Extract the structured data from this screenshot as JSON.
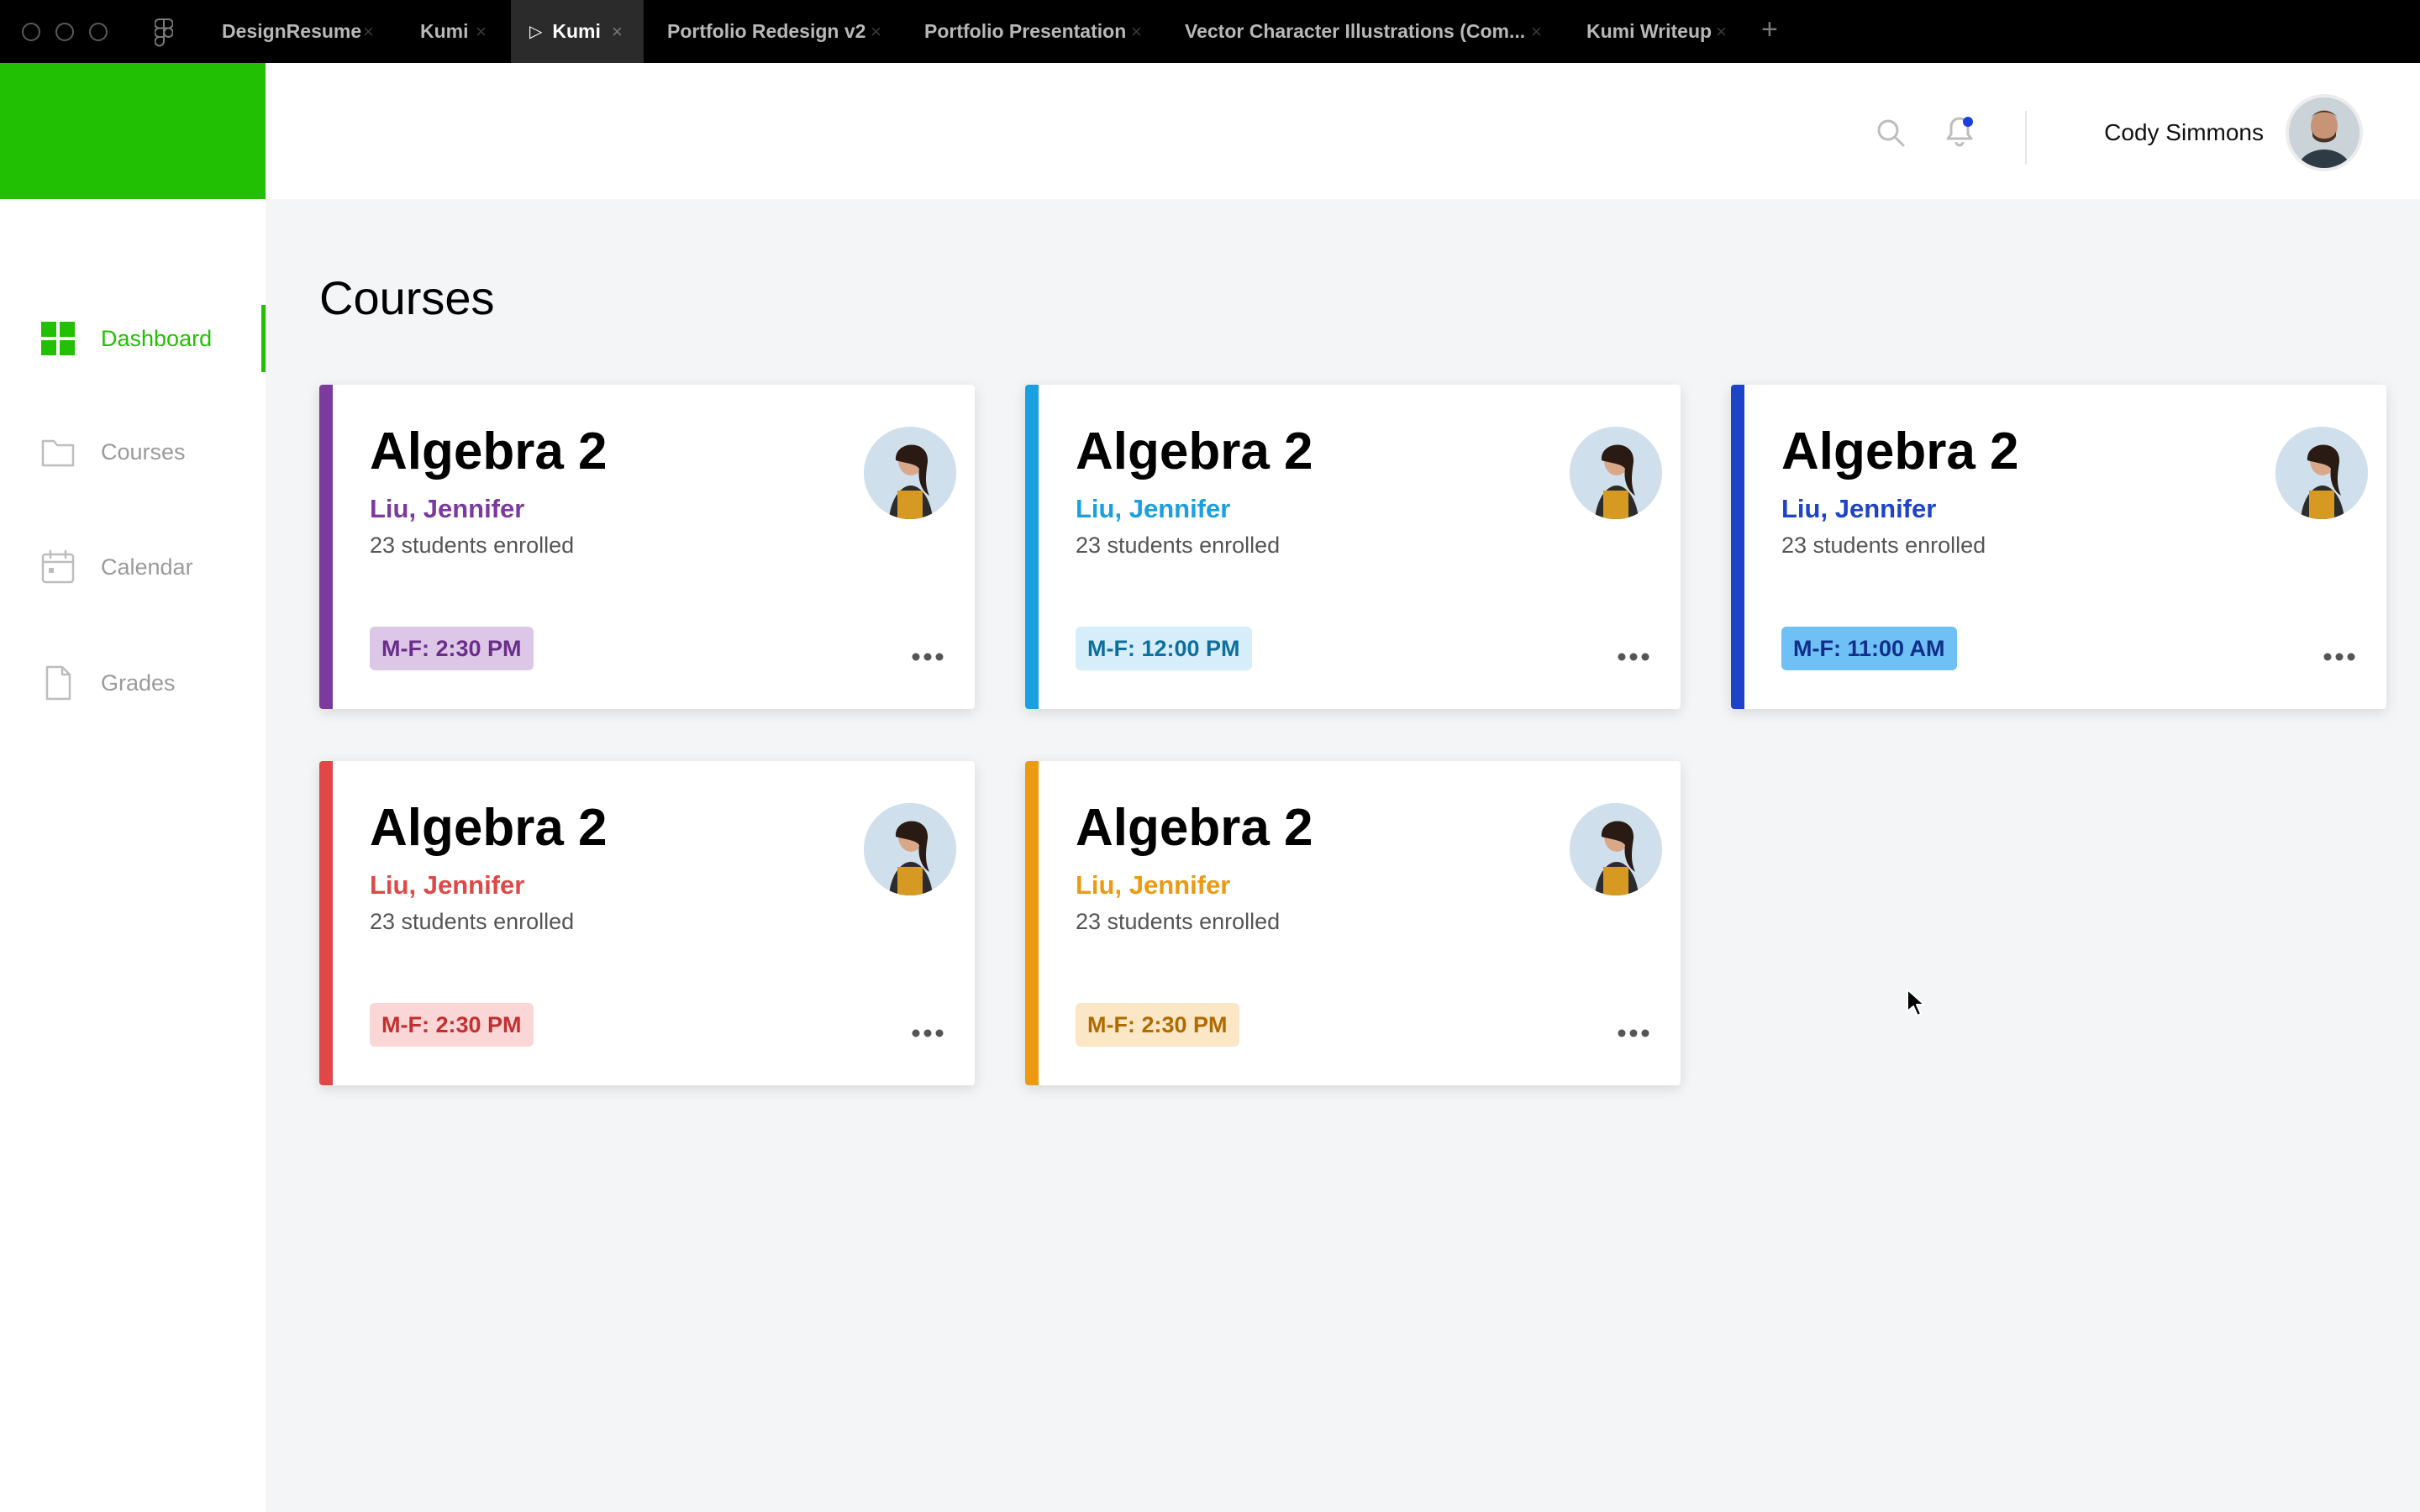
{
  "titlebar": {
    "tabs": [
      {
        "label": "DesignResume",
        "active": false
      },
      {
        "label": "Kumi",
        "active": false
      },
      {
        "label": "Kumi",
        "active": true
      },
      {
        "label": "Portfolio Redesign v2",
        "active": false
      },
      {
        "label": "Portfolio Presentation",
        "active": false
      },
      {
        "label": "Vector Character Illustrations (Com...",
        "active": false
      },
      {
        "label": "Kumi Writeup",
        "active": false
      }
    ],
    "close_glyph": "×",
    "new_tab_glyph": "+",
    "play_glyph": "▷"
  },
  "header": {
    "user_name": "Cody Simmons",
    "accent_color": "#22c002",
    "notification_dot_color": "#1d3fe0"
  },
  "sidebar": {
    "items": [
      {
        "label": "Dashboard",
        "icon": "dashboard-grid-icon",
        "active": true
      },
      {
        "label": "Courses",
        "icon": "folder-icon",
        "active": false
      },
      {
        "label": "Calendar",
        "icon": "calendar-icon",
        "active": false
      },
      {
        "label": "Grades",
        "icon": "document-icon",
        "active": false
      }
    ]
  },
  "main": {
    "title": "Courses",
    "cards": [
      {
        "title": "Algebra 2",
        "teacher": "Liu, Jennifer",
        "enrolled": "23 students enrolled",
        "schedule": "M-F: 2:30 PM",
        "accent": "#7c3a9e",
        "badge_bg": "#dcc8e6",
        "badge_fg": "#6a2d8a"
      },
      {
        "title": "Algebra 2",
        "teacher": "Liu, Jennifer",
        "enrolled": "23 students enrolled",
        "schedule": "M-F: 12:00 PM",
        "accent": "#1aa0e0",
        "badge_bg": "#d6eefa",
        "badge_fg": "#0d6f9e"
      },
      {
        "title": "Algebra 2",
        "teacher": "Liu, Jennifer",
        "enrolled": "23 students enrolled",
        "schedule": "M-F: 11:00 AM",
        "accent": "#1d43c8",
        "badge_bg": "#6fc0f5",
        "badge_fg": "#0f2f8a"
      },
      {
        "title": "Algebra 2",
        "teacher": "Liu, Jennifer",
        "enrolled": "23 students enrolled",
        "schedule": "M-F: 2:30 PM",
        "accent": "#e04848",
        "badge_bg": "#fad6d6",
        "badge_fg": "#c23030"
      },
      {
        "title": "Algebra 2",
        "teacher": "Liu, Jennifer",
        "enrolled": "23 students enrolled",
        "schedule": "M-F: 2:30 PM",
        "accent": "#eb9a12",
        "badge_bg": "#fbe6c6",
        "badge_fg": "#b06a00"
      }
    ]
  }
}
